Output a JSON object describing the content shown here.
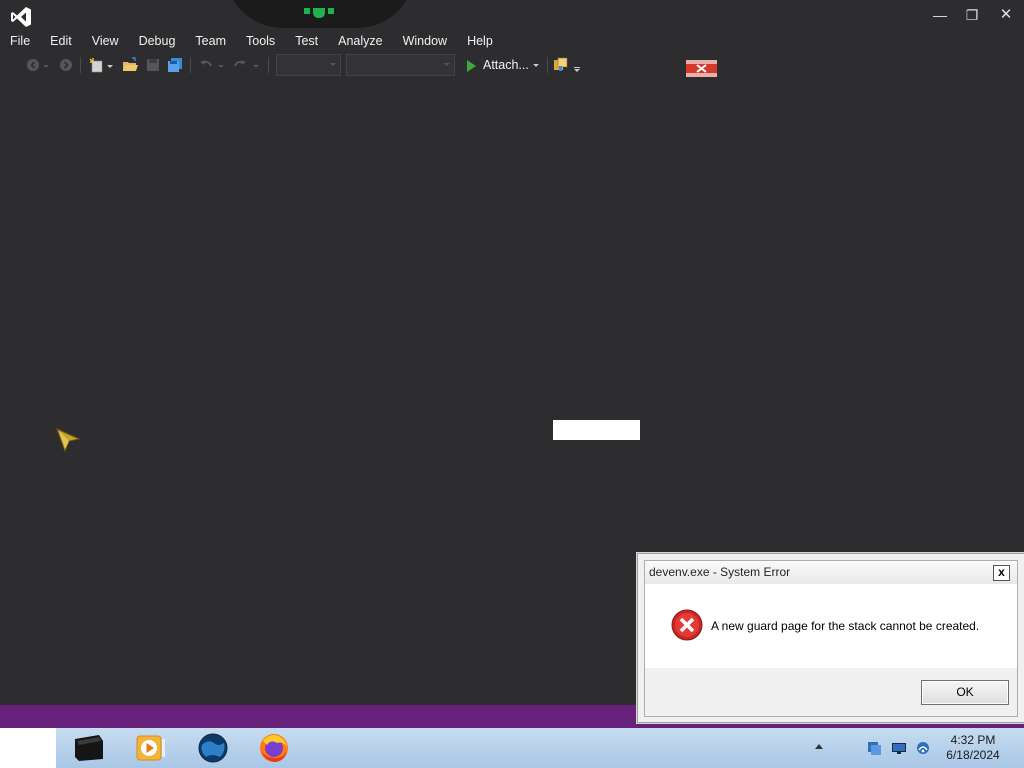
{
  "window": {
    "controls": {
      "minimize": "—",
      "restore": "❐",
      "close": "✕"
    }
  },
  "menu": [
    "File",
    "Edit",
    "View",
    "Debug",
    "Team",
    "Tools",
    "Test",
    "Analyze",
    "Window",
    "Help"
  ],
  "toolbar": {
    "attach_label": "Attach...",
    "icons": [
      "back-icon",
      "forward-icon",
      "new-project-icon",
      "open-file-icon",
      "save-icon",
      "save-all-icon",
      "undo-icon",
      "redo-icon",
      "attach-play-icon",
      "find-in-files-icon"
    ]
  },
  "dialog": {
    "title": "devenv.exe - System Error",
    "close": "x",
    "message": "A new guard page for the stack cannot be created.",
    "ok_label": "OK",
    "icon": "error-icon"
  },
  "taskbar": {
    "apps": [
      "visual-studio-icon",
      "media-player-icon",
      "globe-icon",
      "firefox-icon"
    ],
    "tray": [
      "network-icon",
      "display-icon",
      "wifi-icon"
    ],
    "clock_time": "4:32 PM",
    "clock_date": "6/18/2024"
  },
  "colors": {
    "ide_background": "#2d2d30",
    "status_bar": "#68217a",
    "accent_green": "#3ea63e",
    "taskbar": "#b6d1ec"
  }
}
